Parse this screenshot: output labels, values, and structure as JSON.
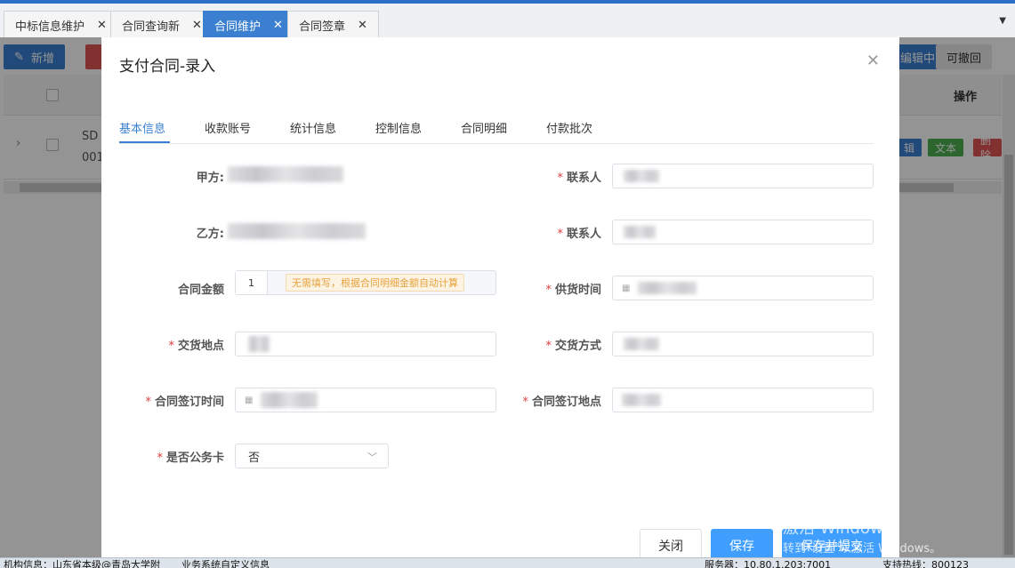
{
  "tabs": [
    {
      "label": "中标信息维护",
      "active": false
    },
    {
      "label": "合同查询新",
      "active": false
    },
    {
      "label": "合同维护",
      "active": true
    },
    {
      "label": "合同签章",
      "active": false
    }
  ],
  "background": {
    "add_button": "新增",
    "edit_in_progress_button": "编辑中",
    "revocable_button": "可撤回",
    "column_action": "操作",
    "row_code_partial_1": "SD",
    "row_code_partial_2": "001",
    "tag_edit": "辑",
    "tag_text": "文本",
    "tag_delete": "删除"
  },
  "modal": {
    "title": "支付合同-录入",
    "tabs": [
      "基本信息",
      "收款账号",
      "统计信息",
      "控制信息",
      "合同明细",
      "付款批次"
    ],
    "active_tab": "基本信息",
    "fields": {
      "party_a_label": "甲方:",
      "party_b_label": "乙方:",
      "contact_a_label": "联系人",
      "contact_b_label": "联系人",
      "amount_label": "合同金额",
      "amount_value": "1",
      "amount_hint": "无需填写，根据合同明细金额自动计算",
      "supply_time_label": "供货时间",
      "delivery_place_label": "交货地点",
      "delivery_method_label": "交货方式",
      "sign_time_label": "合同签订时间",
      "sign_place_label": "合同签订地点",
      "official_card_label": "是否公务卡",
      "official_card_value": "否"
    },
    "buttons": {
      "close": "关闭",
      "save": "保存",
      "save_submit": "保存并提交"
    }
  },
  "watermark": {
    "line1": "激活 Windows",
    "line2": "转到\"设置\"以激活 Windows。"
  },
  "statusbar": {
    "org_info": "机构信息：山东省本级@青岛大学附",
    "custom_info": "业务系统自定义信息",
    "server": "服务器：10.80.1.203:7001",
    "support": "支持热线：800123"
  },
  "colors": {
    "primary": "#3a7fd0",
    "required": "#e04040",
    "hint_text": "#e6a23c",
    "tag_blue": "#3a7fd0",
    "tag_green": "#4caf50",
    "tag_red": "#e05555"
  }
}
